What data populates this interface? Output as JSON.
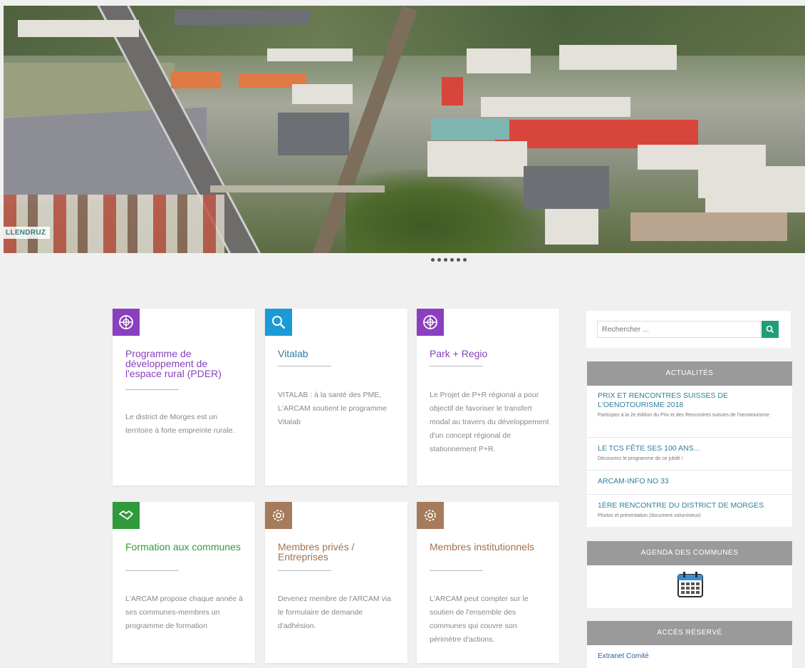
{
  "hero": {
    "caption": "LLENDRUZ"
  },
  "slider": {
    "dots": 6
  },
  "cards": [
    {
      "title": "Programme de développement de l'espace rural (PDER)",
      "text": "Le district de Morges est un territoire à forte empreinte rurale.",
      "color": "#8a3fbf",
      "title_color": "#8a3fbf",
      "icon": "compass-icon"
    },
    {
      "title": "Vitalab",
      "text": "VITALAB : à la santé des PME, L'ARCAM soutient le programme Vitalab",
      "color": "#1b9ad6",
      "title_color": "#2f7e9c",
      "icon": "magnifier-icon"
    },
    {
      "title": "Park + Regio",
      "text": "Le Projet de P+R régional a pour objectif de favoriser le transfert modal au travers du développement d'un concept régional de stationnement P+R.",
      "color": "#8a3fbf",
      "title_color": "#8a3fbf",
      "icon": "compass-icon"
    },
    {
      "title": "Formation aux communes",
      "text": "L'ARCAM propose chaque année à ses communes-membres un programme de formation",
      "color": "#2f9a3a",
      "title_color": "#2f9a3a",
      "icon": "handshake-icon"
    },
    {
      "title": "Membres privés / Entreprises",
      "text": "Devenez membre de l'ARCAM via le formulaire de demande d'adhésion.",
      "color": "#a57b5b",
      "title_color": "#a5714b",
      "icon": "gear-icon"
    },
    {
      "title": "Membres institutionnels",
      "text": "L'ARCAM peut compter sur le soutien de l'ensemble des communes qui couvre son périmètre d'actions.",
      "color": "#a57b5b",
      "title_color": "#a5714b",
      "icon": "gear-icon"
    }
  ],
  "search": {
    "placeholder": "Rechercher ..."
  },
  "actualites": {
    "heading": "ACTUALITÉS",
    "items": [
      {
        "title": "PRIX ET RENCONTRES SUISSES DE L'OENOTOURISME 2018",
        "sub": "Participez à la 2e édition du Prix et des Rencontres suisses de l'oenotourisme"
      },
      {
        "title": "LE TCS FÊTE SES 100 ANS...",
        "sub": "Découvrez le programme de ce jubilé !"
      },
      {
        "title": "ARCAM-INFO NO 33",
        "sub": ""
      },
      {
        "title": "1ÈRE RENCONTRE DU DISTRICT DE MORGES",
        "sub": "Photos et présentation (document volumineux)"
      }
    ]
  },
  "agenda": {
    "heading": "AGENDA DES COMMUNES"
  },
  "reserved": {
    "heading": "ACCÈS RÉSERVÉ",
    "link": "Extranet Comité"
  }
}
